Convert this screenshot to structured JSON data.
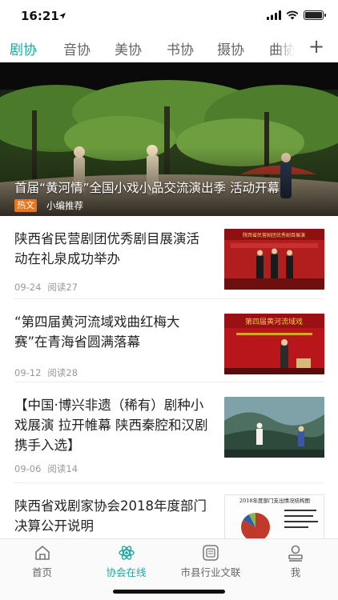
{
  "status_bar": {
    "time": "16:21"
  },
  "tabs": {
    "items": [
      {
        "label": "剧协",
        "active": true
      },
      {
        "label": "音协"
      },
      {
        "label": "美协"
      },
      {
        "label": "书协"
      },
      {
        "label": "摄协"
      },
      {
        "label": "曲协"
      }
    ],
    "add_label": "+"
  },
  "banner": {
    "title": "首届“黄河情”全国小戏小品交流演出季 活动开幕",
    "tag": "热文",
    "source": "小编推荐"
  },
  "news": [
    {
      "title": "陕西省民营剧团优秀剧目展演活动在礼泉成功举办",
      "date": "09-24",
      "reads": "阅读27",
      "thumb_caption": "陕西省民营剧团优秀剧目展演"
    },
    {
      "title": "“第四届黄河流域戏曲红梅大赛”在青海省圆满落幕",
      "date": "09-12",
      "reads": "阅读28",
      "thumb_caption": "第四届黄河流域戏"
    },
    {
      "title": "【中国·博兴非遗（稀有）剧种小戏展演 拉开帷幕 陕西秦腔和汉剧携手入选】",
      "date": "09-06",
      "reads": "阅读14"
    },
    {
      "title": "陕西省戏剧家协会2018年度部门决算公开说明",
      "thumb_caption": "2018年度部门支出情况结构图"
    }
  ],
  "bottom_nav": [
    {
      "label": "首页",
      "icon": "home-icon"
    },
    {
      "label": "协会在线",
      "icon": "atom-icon",
      "active": true
    },
    {
      "label": "市县行业文联",
      "icon": "building-icon"
    },
    {
      "label": "我",
      "icon": "profile-icon"
    }
  ],
  "colors": {
    "accent": "#1ea89e",
    "tag": "#e8751a"
  }
}
